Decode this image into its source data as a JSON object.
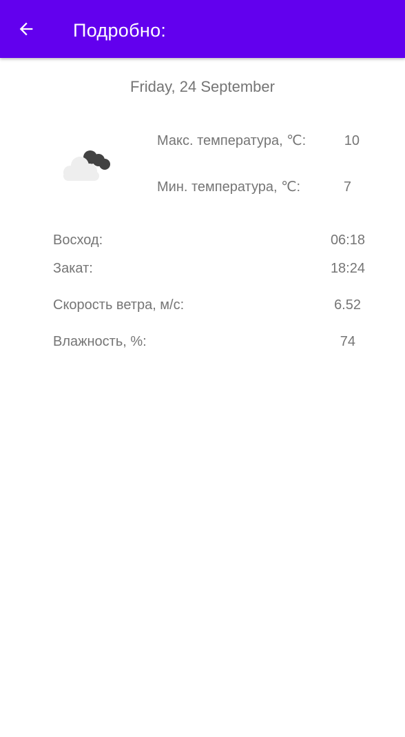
{
  "appbar": {
    "title": "Подробно:",
    "back_icon": "arrow-left-icon",
    "color": "#6200ee"
  },
  "forecast": {
    "date": "Friday, 24 September",
    "icon": "cloudy-icon",
    "max_temp_label": "Макс. температура, ℃:",
    "max_temp_value": "10",
    "min_temp_label": "Мин. температура, ℃:",
    "min_temp_value": "7"
  },
  "details": {
    "sunrise_label": "Восход:",
    "sunrise_value": "06:18",
    "sunset_label": "Закат:",
    "sunset_value": "18:24",
    "wind_label": "Скорость ветра, м/с:",
    "wind_value": "6.52",
    "humidity_label": "Влажность, %:",
    "humidity_value": "74"
  },
  "colors": {
    "text": "#757575",
    "background": "#ffffff"
  }
}
